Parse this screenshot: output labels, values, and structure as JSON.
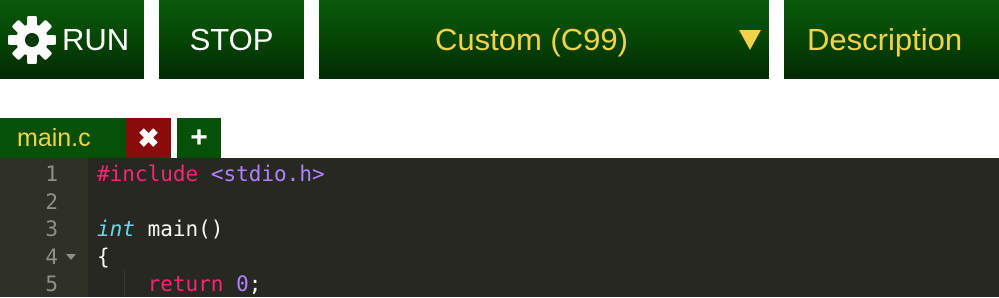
{
  "toolbar": {
    "run_label": "RUN",
    "run_icon": "gear-icon",
    "stop_label": "STOP",
    "language_selected": "Custom (C99)",
    "description_label": "Description"
  },
  "tabs": {
    "file_name": "main.c",
    "close_glyph": "✖",
    "add_glyph": "+"
  },
  "editor": {
    "lines": [
      {
        "num": "1",
        "tokens": [
          {
            "text": "#include",
            "cls": "kw-pink"
          },
          {
            "text": " ",
            "cls": ""
          },
          {
            "text": "<stdio.h>",
            "cls": "kw-purple"
          }
        ]
      },
      {
        "num": "2",
        "tokens": []
      },
      {
        "num": "3",
        "tokens": [
          {
            "text": "int",
            "cls": "kw-type"
          },
          {
            "text": " main()",
            "cls": ""
          }
        ]
      },
      {
        "num": "4",
        "fold": true,
        "tokens": [
          {
            "text": "{",
            "cls": ""
          }
        ]
      },
      {
        "num": "5",
        "indent": true,
        "tokens": [
          {
            "text": "    ",
            "cls": ""
          },
          {
            "text": "return",
            "cls": "kw-pink"
          },
          {
            "text": " ",
            "cls": ""
          },
          {
            "text": "0",
            "cls": "kw-purple"
          },
          {
            "text": ";",
            "cls": ""
          }
        ]
      }
    ]
  },
  "colors": {
    "toolbar_green": "#064806",
    "accent_yellow": "#f2d24a",
    "close_red": "#8a0b0b",
    "editor_bg": "#272822",
    "keyword_pink": "#f92672",
    "literal_purple": "#ae81ff",
    "type_blue": "#66d9ef"
  }
}
